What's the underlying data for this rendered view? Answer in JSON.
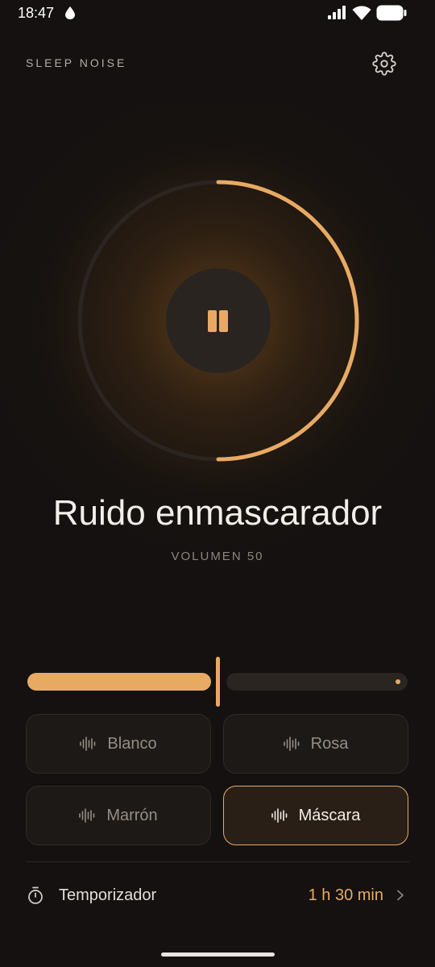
{
  "status_bar": {
    "time": "18:47",
    "icons": [
      "drop-icon",
      "signal-icon",
      "wifi-icon",
      "battery-icon"
    ]
  },
  "header": {
    "title": "SLEEP NOISE",
    "settings_icon": "gear-icon"
  },
  "player": {
    "state": "playing",
    "control_icon": "pause-icon",
    "progress_fraction": 0.5,
    "sound_name": "Ruido enmascarador",
    "volume_caption": "VOLUMEN 50",
    "volume_value": 50
  },
  "noise_types": [
    {
      "label": "Blanco",
      "icon": "waveform-icon",
      "selected": false
    },
    {
      "label": "Rosa",
      "icon": "waveform-icon",
      "selected": false
    },
    {
      "label": "Marrón",
      "icon": "waveform-icon",
      "selected": false
    },
    {
      "label": "Máscara",
      "icon": "waveform-icon",
      "selected": true
    }
  ],
  "timer": {
    "label": "Temporizador",
    "value": "1 h 30 min",
    "icon": "stopwatch-icon"
  },
  "colors": {
    "accent": "#e8aa63",
    "background": "#141110",
    "ring_track": "#2b2522"
  }
}
